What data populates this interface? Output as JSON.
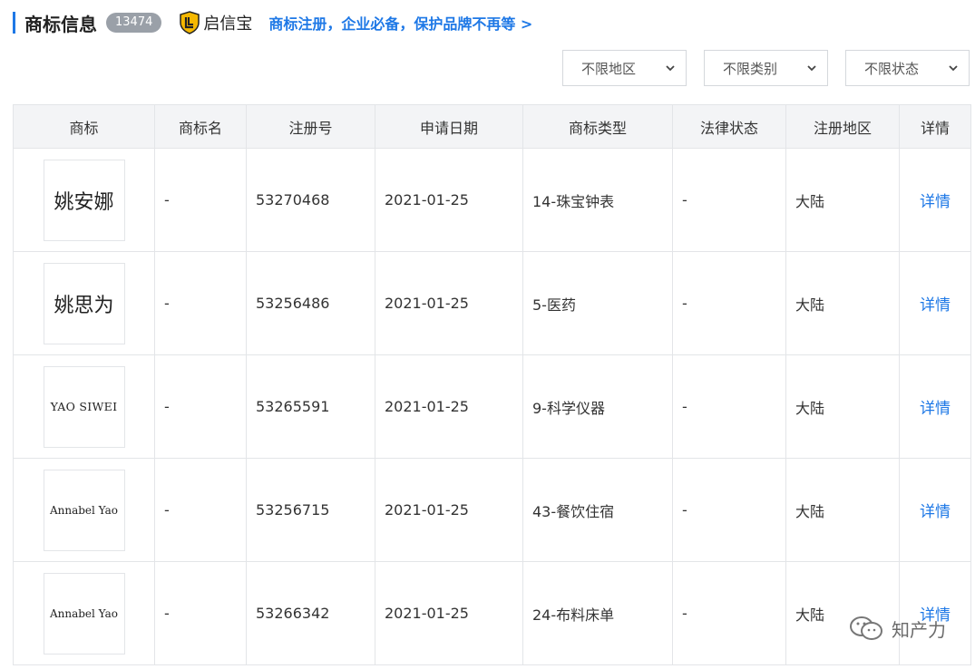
{
  "header": {
    "title": "商标信息",
    "count": "13474",
    "brand_name": "启信宝",
    "promo": "商标注册，企业必备，保护品牌不再等 >"
  },
  "filters": [
    {
      "value": "不限地区"
    },
    {
      "value": "不限类别"
    },
    {
      "value": "不限状态"
    }
  ],
  "table": {
    "columns": [
      "商标",
      "商标名",
      "注册号",
      "申请日期",
      "商标类型",
      "法律状态",
      "注册地区",
      "详情"
    ],
    "rows": [
      {
        "logo_text": "姚安娜",
        "name": "-",
        "reg_no": "53270468",
        "date": "2021-01-25",
        "type": "14-珠宝钟表",
        "status": "-",
        "region": "大陆",
        "detail": "详情"
      },
      {
        "logo_text": "姚思为",
        "name": "-",
        "reg_no": "53256486",
        "date": "2021-01-25",
        "type": "5-医药",
        "status": "-",
        "region": "大陆",
        "detail": "详情"
      },
      {
        "logo_text": "YAO SIWEI",
        "name": "-",
        "reg_no": "53265591",
        "date": "2021-01-25",
        "type": "9-科学仪器",
        "status": "-",
        "region": "大陆",
        "detail": "详情"
      },
      {
        "logo_text": "Annabel Yao",
        "name": "-",
        "reg_no": "53256715",
        "date": "2021-01-25",
        "type": "43-餐饮住宿",
        "status": "-",
        "region": "大陆",
        "detail": "详情"
      },
      {
        "logo_text": "Annabel Yao",
        "name": "-",
        "reg_no": "53266342",
        "date": "2021-01-25",
        "type": "24-布料床单",
        "status": "-",
        "region": "大陆",
        "detail": "详情"
      }
    ]
  },
  "watermark": {
    "text": "知产力"
  },
  "colors": {
    "accent": "#1e78e6",
    "badge": "#9aa0a8",
    "header_bg": "#f3f4f6",
    "border": "#e3e5e8"
  }
}
